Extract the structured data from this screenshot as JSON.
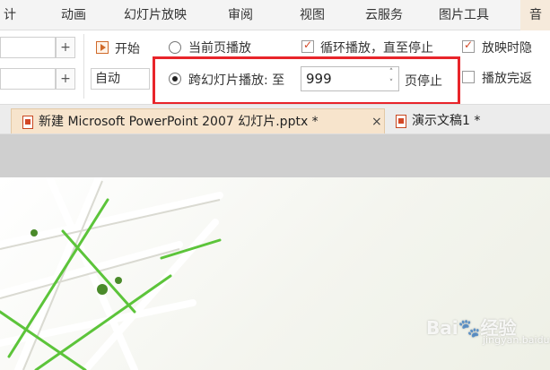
{
  "menu": {
    "tabs": [
      {
        "label": "计"
      },
      {
        "label": "动画"
      },
      {
        "label": "幻灯片放映"
      },
      {
        "label": "审阅"
      },
      {
        "label": "视图"
      },
      {
        "label": "云服务"
      },
      {
        "label": "图片工具"
      },
      {
        "label": "音"
      }
    ]
  },
  "ribbon": {
    "row2_select_value": "自动",
    "plus_label": "+",
    "start_label": "开始",
    "radio_current_page": "当前页播放",
    "radio_cross_slide": "跨幻灯片播放: 至",
    "cross_slide_value": "999",
    "page_stop_label": "页停止",
    "loop_label": "循环播放，直至停止",
    "hide_when_playing_label": "放映时隐",
    "rewind_label": "播放完返"
  },
  "docs": {
    "tabs": [
      {
        "label": "新建 Microsoft PowerPoint 2007 幻灯片.pptx *"
      },
      {
        "label": "演示文稿1 *"
      }
    ],
    "close_symbol": "×"
  },
  "watermark": {
    "brand": "Bai",
    "brand_suffix": "经验",
    "sub": "jingyan.baidu.com"
  },
  "colors": {
    "highlight": "#e8242a",
    "active_tab": "#f6eadb",
    "active_doc_tab": "#f7e4cc",
    "accent": "#d24726"
  }
}
